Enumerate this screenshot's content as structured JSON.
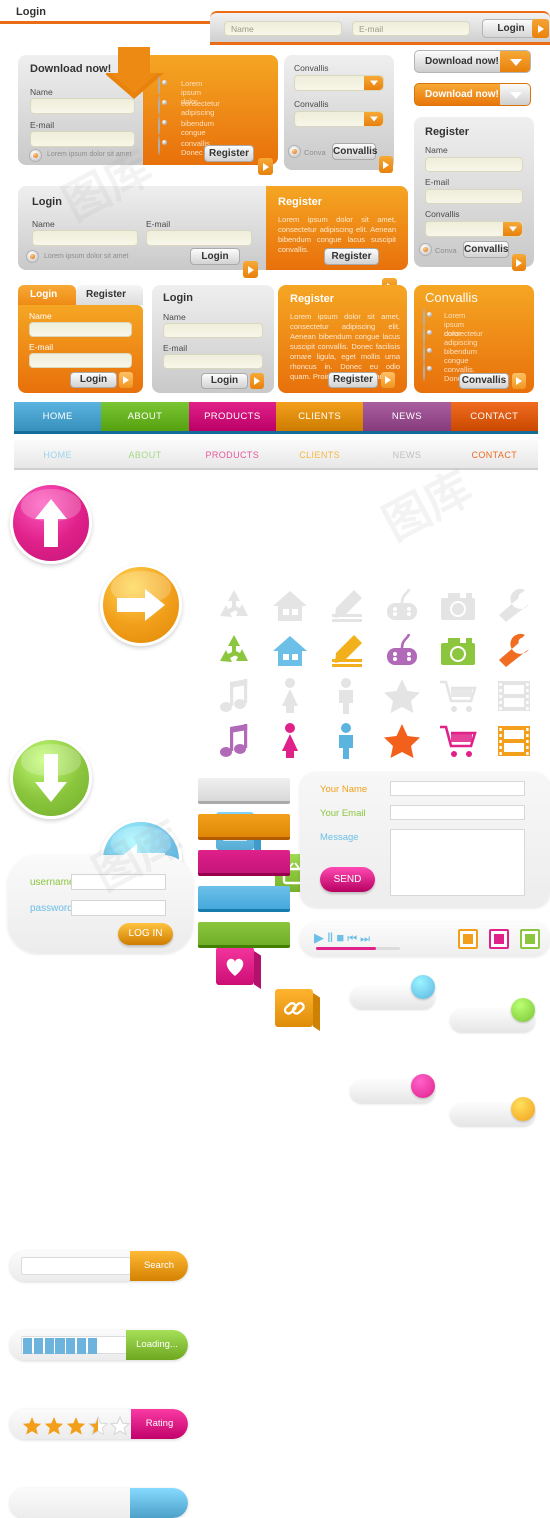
{
  "topbar": {
    "title": "Login",
    "name_placeholder": "Name",
    "email_placeholder": "E-mail",
    "login_label": "Login"
  },
  "download_panel": {
    "title": "Download now!",
    "name_label": "Name",
    "email_label": "E-mail",
    "checkbox_label": "Lorem ipsum dolor sit amet",
    "register_label": "Register",
    "list": [
      "Lorem   ipsum   dolor",
      "consectetur adipiscing",
      "bibendum  congue",
      "convallis.  Donec"
    ]
  },
  "convallis_select_panel": {
    "label1": "Convallis",
    "label2": "Convallis",
    "checkbox_label": "Conva",
    "button_label": "Convallis"
  },
  "download_buttons": {
    "grey_label": "Download now!",
    "orange_label": "Download now!"
  },
  "register_panel": {
    "title": "Register",
    "name_label": "Name",
    "email_label": "E-mail",
    "convallis_label": "Convallis",
    "checkbox_label": "Conva",
    "button_label": "Convallis"
  },
  "login_register_wide": {
    "login_title": "Login",
    "name_label": "Name",
    "email_label": "E-mail",
    "checkbox_label": "Lorem ipsum dolor sit amet",
    "login_button": "Login",
    "register_title": "Register",
    "register_body": "Lorem ipsum dolor sit amet, consectetur adipiscing elit. Aenean bibendum congue lacus suscipit convallis.",
    "register_button": "Register"
  },
  "tabbed_login": {
    "tab_login": "Login",
    "tab_register": "Register",
    "name_label": "Name",
    "email_label": "E-mail",
    "login_button": "Login"
  },
  "grey_login": {
    "title": "Login",
    "name_label": "Name",
    "email_label": "E-mail",
    "login_button": "Login"
  },
  "register_text_panel": {
    "title": "Register",
    "body": "Lorem ipsum dolor sit amet, consectetur adipiscing elit. Aenean bibendum congue lacus suscipit convallis. Donec facilisis ornare ligula, eget mollis urna rhoncus in. Donec eu odio quam. Proin vitae porta diam.",
    "button": "Register"
  },
  "convallis_list_panel": {
    "title": "Convallis",
    "items": [
      "Lorem   ipsum   dolor",
      "consectetur adipiscing",
      "bibendum  congue",
      "convallis.  Donec"
    ],
    "button": "Convallis"
  },
  "nav_primary": {
    "items": [
      {
        "label": "HOME",
        "color": "#5bb4e0"
      },
      {
        "label": "ABOUT",
        "color": "#7ac534"
      },
      {
        "label": "PRODUCTS",
        "color": "#e0218a"
      },
      {
        "label": "CLIENTS",
        "color": "#f2a01c"
      },
      {
        "label": "NEWS",
        "color": "#a95fa0"
      },
      {
        "label": "CONTACT",
        "color": "#ef6c21"
      }
    ]
  },
  "nav_secondary": {
    "items": [
      {
        "label": "HOME",
        "color": "#9dd4ec"
      },
      {
        "label": "ABOUT",
        "color": "#a6d985"
      },
      {
        "label": "PRODUCTS",
        "color": "#e8569b"
      },
      {
        "label": "CLIENTS",
        "color": "#f5b83e"
      },
      {
        "label": "NEWS",
        "color": "#c0c0c0"
      },
      {
        "label": "CONTACT",
        "color": "#ef6c21"
      }
    ]
  },
  "round_buttons": [
    {
      "name": "arrow-up-button",
      "color": "#e0218a",
      "dark": "#c4157a",
      "dir": "up"
    },
    {
      "name": "arrow-right-button",
      "color": "#f2a01c",
      "dark": "#e08806",
      "dir": "right"
    },
    {
      "name": "arrow-down-button",
      "color": "#8cc63f",
      "dark": "#6fae27",
      "dir": "down"
    },
    {
      "name": "arrow-left-button",
      "color": "#6cc0e8",
      "dark": "#46a9dc",
      "dir": "left"
    }
  ],
  "square_icons": [
    {
      "name": "mail-icon",
      "color": "#6cc0e8",
      "side": "#3d9ccb",
      "glyph": "✉"
    },
    {
      "name": "tv-icon",
      "color": "#8cc63f",
      "side": "#6aa72a",
      "glyph": "▢"
    },
    {
      "name": "heart-icon",
      "color": "#e0218a",
      "side": "#b3126c",
      "glyph": "♥"
    },
    {
      "name": "link-icon",
      "color": "#f2a01c",
      "side": "#cd8206",
      "glyph": "⚭"
    }
  ],
  "toggles": [
    {
      "name": "toggle-blue",
      "color": "#5bb4e0",
      "state": "on"
    },
    {
      "name": "toggle-green",
      "color": "#7ac534",
      "state": "on"
    },
    {
      "name": "toggle-pink",
      "color": "#e0218a",
      "state": "off"
    },
    {
      "name": "toggle-orange",
      "color": "#f2a01c",
      "state": "off"
    }
  ],
  "flat_icons": {
    "row1": [
      {
        "name": "recycle-icon",
        "color": "#8cc63f"
      },
      {
        "name": "home-icon",
        "color": "#6cc0e8"
      },
      {
        "name": "pencil-icon",
        "color": "#f2b01c"
      },
      {
        "name": "gamepad-icon",
        "color": "#b06ab8"
      },
      {
        "name": "camera-icon",
        "color": "#8cc63f"
      },
      {
        "name": "wrench-icon",
        "color": "#ef6c21"
      }
    ],
    "row2": [
      {
        "name": "music-note-icon",
        "color": "#b06ab8"
      },
      {
        "name": "woman-icon",
        "color": "#e0218a"
      },
      {
        "name": "man-icon",
        "color": "#5bb4e0"
      },
      {
        "name": "star-icon",
        "color": "#f2601c"
      },
      {
        "name": "shopping-cart-icon",
        "color": "#e0218a"
      },
      {
        "name": "film-icon",
        "color": "#f2a01c"
      }
    ],
    "ghost_color": "#e4e4e4"
  },
  "widgets": {
    "search": {
      "label": "Search",
      "color": "#f2a01c",
      "value": ""
    },
    "loading": {
      "label": "Loading...",
      "color": "#8cc63f",
      "bar_color": "#6cb3dd",
      "blocks": 7,
      "total": 10
    },
    "rating": {
      "label": "Rating",
      "color": "#e0218a",
      "stars": 3.5,
      "max": 5,
      "star_color": "#f2a01c"
    },
    "plain": {
      "color": "#6cc0e8"
    }
  },
  "login_box": {
    "username_label": "username",
    "password_label": "password",
    "username_value": "",
    "password_value": "",
    "button_label": "LOG IN",
    "username_color": "#8cc63f",
    "password_color": "#6cc0e8",
    "button_color": "#f2a01c"
  },
  "color_bars": [
    {
      "name": "bar-grey",
      "color": "#f0f0f0",
      "dark": "#d8d8d8"
    },
    {
      "name": "bar-orange",
      "color": "#f2a01c",
      "dark": "#e08806"
    },
    {
      "name": "bar-pink",
      "color": "#e0218a",
      "dark": "#c4157a"
    },
    {
      "name": "bar-blue",
      "color": "#6cc0e8",
      "dark": "#46a9dc"
    },
    {
      "name": "bar-green",
      "color": "#8cc63f",
      "dark": "#6fae27"
    }
  ],
  "contact_form": {
    "name_label": "Your Name",
    "email_label": "Your Email",
    "message_label": "Message",
    "name_value": "",
    "email_value": "",
    "message_value": "",
    "send_label": "SEND",
    "name_color": "#f2a01c",
    "email_color": "#8cc63f",
    "message_color": "#6cc0e8",
    "send_color": "#e0218a"
  },
  "media_player": {
    "controls": [
      "play",
      "pause",
      "stop",
      "previous",
      "next"
    ],
    "play_glyph": "▶",
    "pause_glyph": "Ⅱ",
    "stop_glyph": "■",
    "prev_glyph": "⏮",
    "next_glyph": "⏭",
    "progress_percent": 72,
    "progress_color": "#e0218a",
    "right_buttons": [
      {
        "name": "volume-icon",
        "color": "#f2a01c"
      },
      {
        "name": "resize-icon",
        "color": "#e0218a"
      },
      {
        "name": "fullscreen-icon",
        "color": "#8cc63f"
      }
    ]
  }
}
